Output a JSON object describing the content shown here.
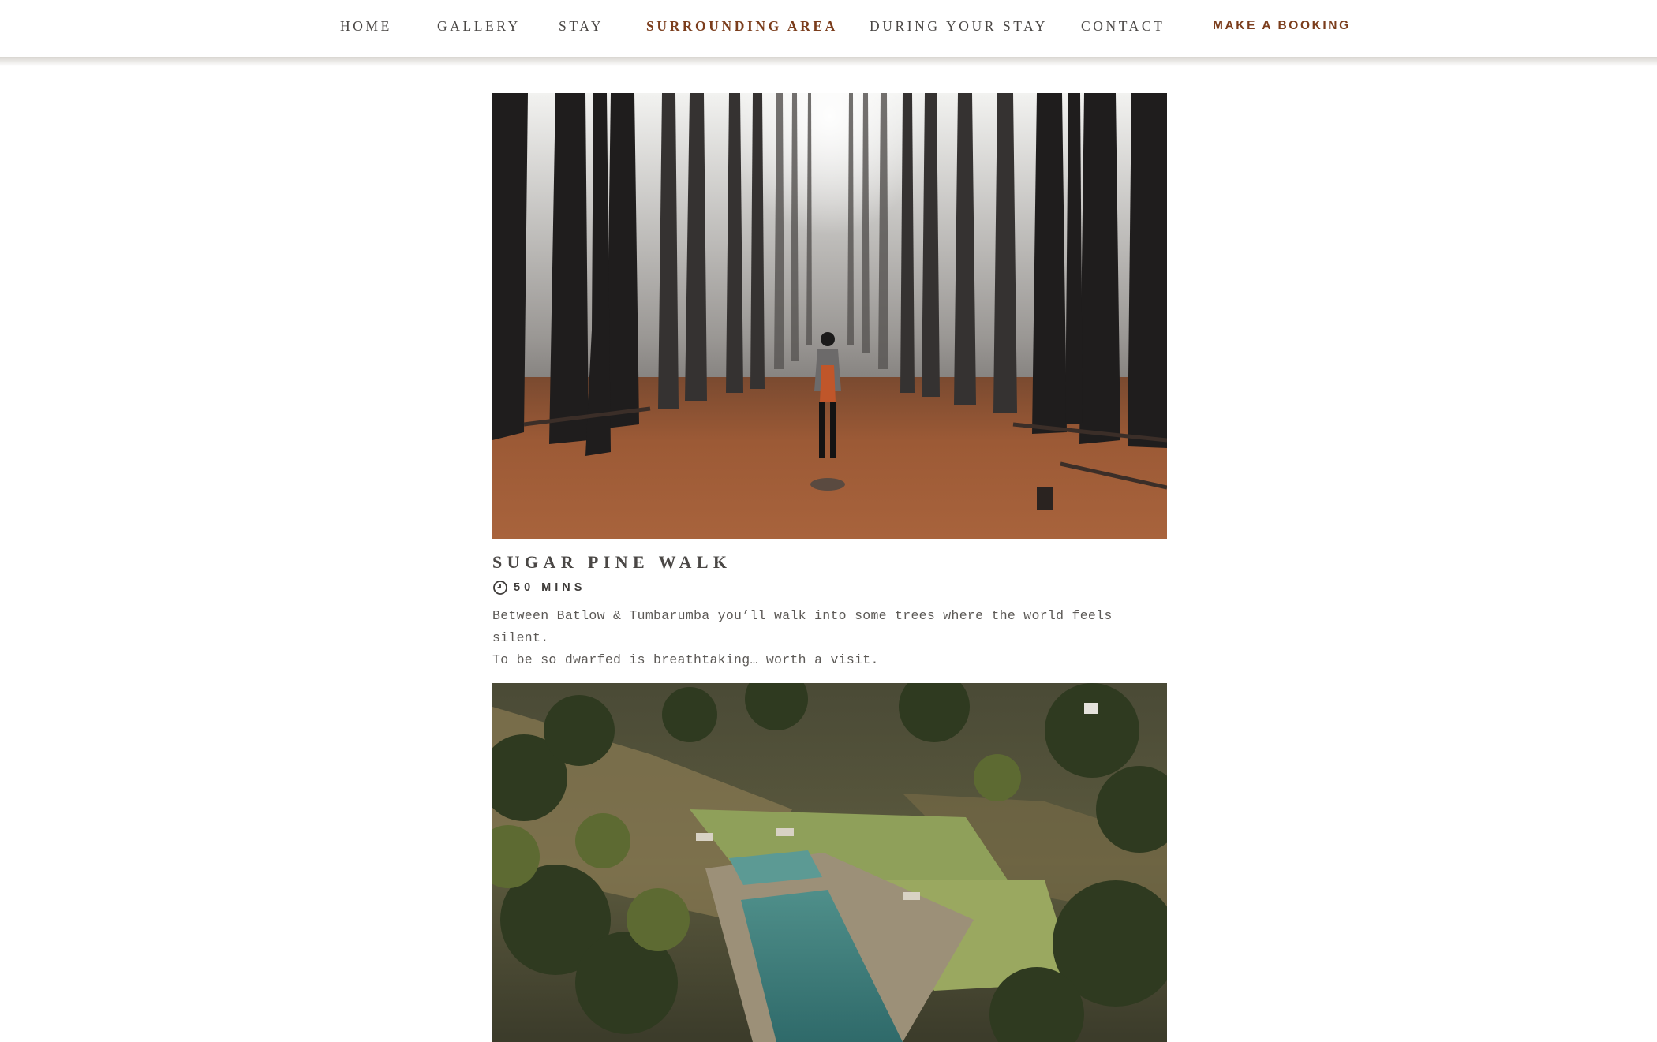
{
  "nav": {
    "items": [
      {
        "label": "HOME",
        "active": false
      },
      {
        "label": "GALLERY",
        "active": false
      },
      {
        "label": "STAY",
        "active": false
      },
      {
        "label": "SURROUNDING AREA",
        "active": true
      },
      {
        "label": "DURING YOUR STAY",
        "active": false
      },
      {
        "label": "CONTACT",
        "active": false
      }
    ],
    "cta_label": "MAKE A BOOKING"
  },
  "colors": {
    "accent": "#7b3d1c",
    "nav_text": "#4a4745",
    "body_text": "#5c5956"
  },
  "attractions": [
    {
      "title": "SUGAR PINE WALK",
      "duration": "50 MINS",
      "description_line1": "Between Batlow & Tumbarumba you’ll walk into some trees where the world feels silent.",
      "description_line2": "To be so dwarfed is breathtaking… worth a visit.",
      "icon": "clock-icon"
    }
  ]
}
